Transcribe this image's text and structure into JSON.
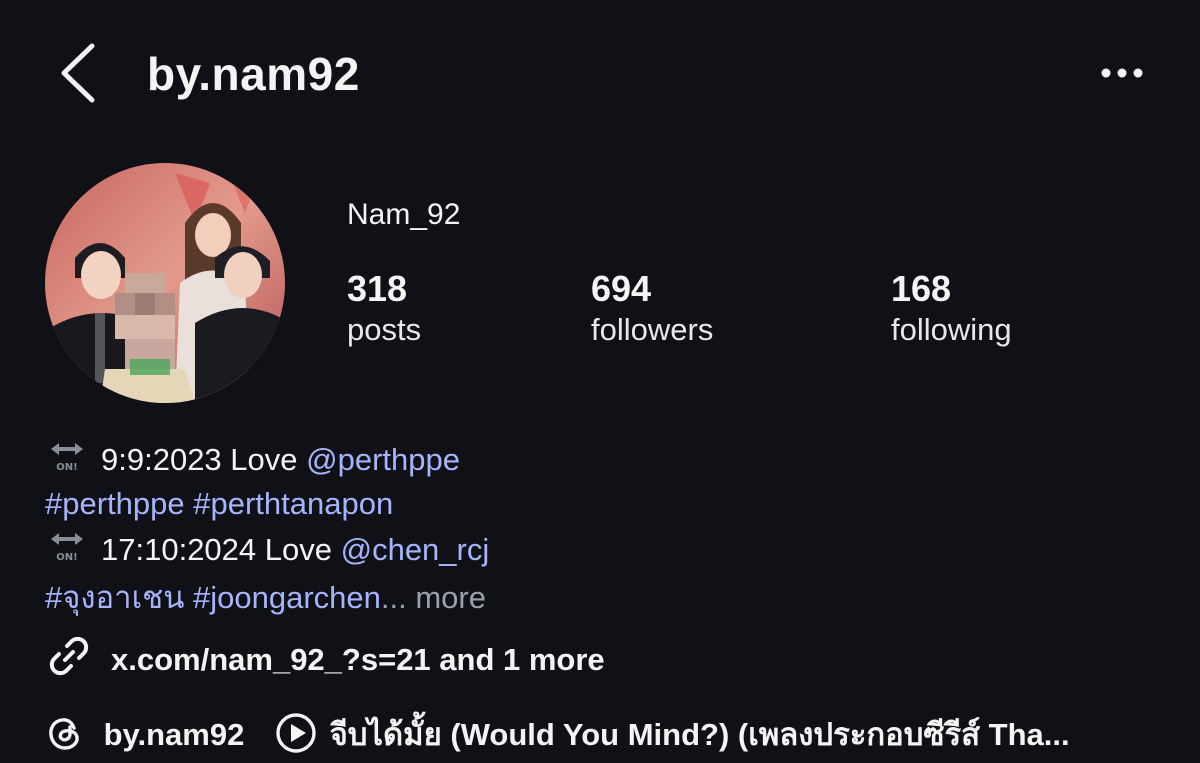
{
  "header": {
    "username": "by.nam92",
    "back_icon": "chevron-left-icon",
    "more_icon": "more-horizontal-icon"
  },
  "profile": {
    "display_name": "Nam_92",
    "stats": [
      {
        "value": "318",
        "label": "posts"
      },
      {
        "value": "694",
        "label": "followers"
      },
      {
        "value": "168",
        "label": "following"
      }
    ]
  },
  "bio": {
    "line1": {
      "text": "9:9:2023 Love ",
      "mention": "@perthppe"
    },
    "line2": {
      "hashtags": "#perthppe #perthtanapon"
    },
    "line3": {
      "text": "17:10:2024 Love ",
      "mention": "@chen_rcj"
    },
    "line4": {
      "hashtags": "#จุงอาเชน #joongarchen",
      "ellipsis": "...",
      "more": " more"
    },
    "on_icon_text": "ON!"
  },
  "link": {
    "icon": "link-icon",
    "text": "x.com/nam_92_?s=21 and 1 more"
  },
  "bottom": {
    "threads_icon": "threads-icon",
    "threads_handle": "by.nam92",
    "music_icon": "play-circle-icon",
    "music_text": "จีบได้มั้ย (Would You Mind?) (เพลงประกอบซีรีส์ Tha..."
  },
  "colors": {
    "background": "#101116",
    "link": "#a6b4ff",
    "text": "#f4f4f5",
    "muted": "#9aa0a8"
  }
}
